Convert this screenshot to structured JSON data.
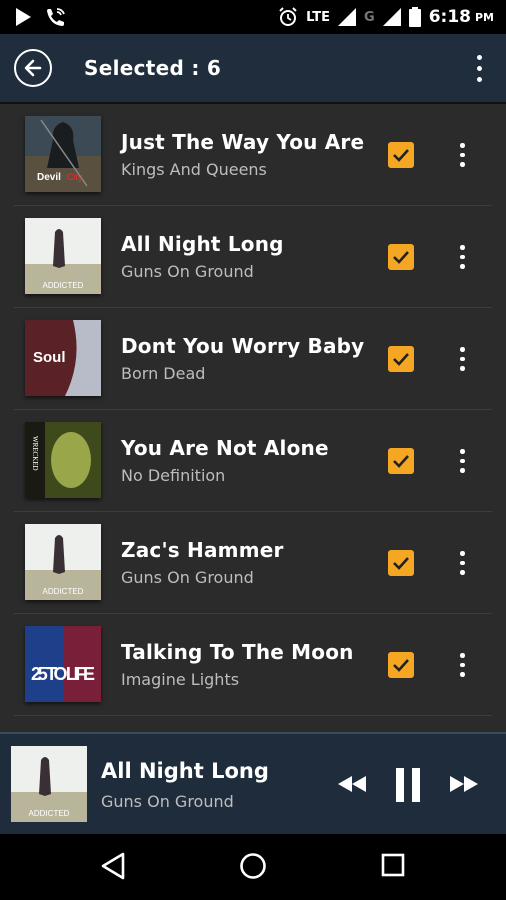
{
  "status_bar": {
    "network": "LTE",
    "carrier_g": "G",
    "time": "6:18",
    "ampm": "PM"
  },
  "header": {
    "title": "Selected : 6"
  },
  "songs": [
    {
      "title": "Just The Way You Are",
      "artist": "Kings And Queens",
      "checked": true,
      "art_text": "Devil"
    },
    {
      "title": "All Night Long",
      "artist": "Guns On Ground",
      "checked": true,
      "art_text": "ADDICTED"
    },
    {
      "title": "Dont You Worry Baby",
      "artist": "Born Dead",
      "checked": true,
      "art_text": "Soul"
    },
    {
      "title": "You Are Not Alone",
      "artist": "No Definition",
      "checked": true,
      "art_text": "WRECKED"
    },
    {
      "title": "Zac's Hammer",
      "artist": "Guns On Ground",
      "checked": true,
      "art_text": "ADDICTED"
    },
    {
      "title": "Talking To The Moon",
      "artist": "Imagine Lights",
      "checked": true,
      "art_text": "25 TO LIFE"
    }
  ],
  "now_playing": {
    "title": "All Night Long",
    "artist": "Guns On Ground",
    "art_text": "ADDICTED"
  },
  "icons": {
    "back": "back-arrow-icon",
    "more": "more-vert-icon",
    "rewind": "rewind-icon",
    "pause": "pause-icon",
    "forward": "fast-forward-icon",
    "nav_back": "nav-back-icon",
    "nav_home": "nav-home-icon",
    "nav_recent": "nav-recents-icon"
  },
  "colors": {
    "accent": "#f5a623",
    "header_bg": "#1f2d3d",
    "list_bg": "#2b2b2b"
  }
}
